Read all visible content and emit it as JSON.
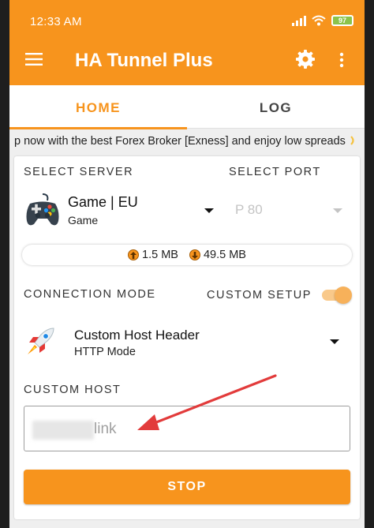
{
  "status": {
    "time": "12:33 AM",
    "battery": "97"
  },
  "appbar": {
    "title": "HA Tunnel Plus"
  },
  "tabs": [
    {
      "label": "HOME"
    },
    {
      "label": "LOG"
    }
  ],
  "marquee": "p now with the best Forex Broker [Exness] and enjoy low spreads",
  "server": {
    "section_label": "SELECT SERVER",
    "name": "Game | EU",
    "type": "Game"
  },
  "port": {
    "section_label": "SELECT PORT",
    "value": "P 80"
  },
  "usage": {
    "upload": "1.5 MB",
    "download": "49.5 MB"
  },
  "connection": {
    "section_label": "CONNECTION MODE",
    "custom_setup_label": "CUSTOM SETUP",
    "custom_setup_enabled": true,
    "mode_name": "Custom Host Header",
    "mode_sub": "HTTP Mode"
  },
  "custom_host": {
    "label": "CUSTOM HOST",
    "value": "link"
  },
  "actions": {
    "stop_label": "STOP"
  },
  "colors": {
    "accent": "#f7941d",
    "arrow": "#e23b3b"
  }
}
